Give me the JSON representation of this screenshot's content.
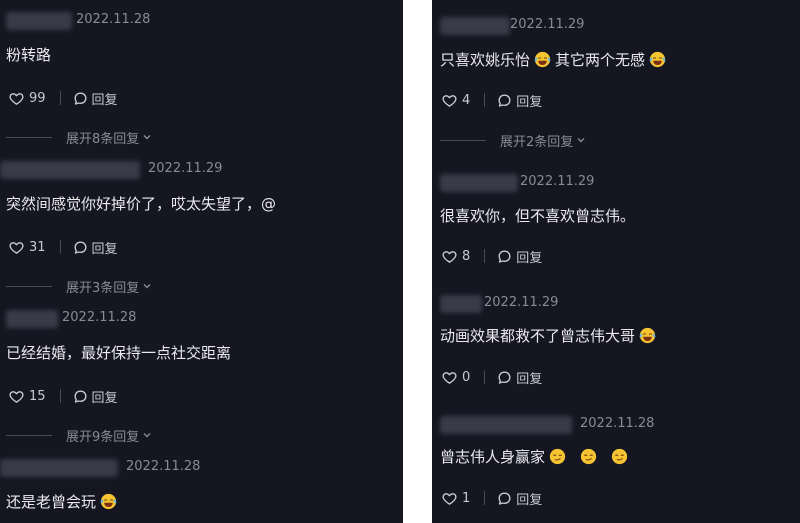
{
  "left_comments": [
    {
      "date": "2022.11.28",
      "text": "粉转路",
      "likes": "99",
      "reply_label": "回复",
      "expand_label": "展开8条回复",
      "expand_icon": "chevron-down-icon"
    },
    {
      "date": "2022.11.29",
      "text": "突然间感觉你好掉价了，哎太失望了，@",
      "likes": "31",
      "reply_label": "回复",
      "expand_label": "展开3条回复",
      "expand_icon": "chevron-down-icon"
    },
    {
      "date": "2022.11.28",
      "text": "已经结婚，最好保持一点社交距离",
      "likes": "15",
      "reply_label": "回复",
      "expand_label": "展开9条回复",
      "expand_icon": "chevron-down-icon"
    },
    {
      "date": "2022.11.28",
      "text": "还是老曾会玩",
      "emoji_after": "laughing-crying-emoji"
    }
  ],
  "right_comments": [
    {
      "date": "2022.11.29",
      "text_before": "只喜欢姚乐怡",
      "text_after": "其它两个无感",
      "emoji_mid": "rolling-laughing-emoji",
      "emoji_end": "tears-of-joy-emoji",
      "likes": "4",
      "reply_label": "回复",
      "expand_label": "展开2条回复",
      "expand_icon": "chevron-down-icon"
    },
    {
      "date": "2022.11.29",
      "text": "很喜欢你，但不喜欢曾志伟。",
      "likes": "8",
      "reply_label": "回复"
    },
    {
      "date": "2022.11.29",
      "text": "动画效果都救不了曾志伟大哥",
      "emoji_end": "tears-of-joy-emoji",
      "likes": "0",
      "reply_label": "回复"
    },
    {
      "date": "2022.11.28",
      "text": "曾志伟人身赢家",
      "emojis": [
        "smirk-emoji",
        "smirk-emoji",
        "smirk-emoji"
      ],
      "likes": "1",
      "reply_label": "回复"
    }
  ],
  "colors": {
    "background": "#161622",
    "text": "#e9e9ee",
    "muted": "#8a8a96",
    "emoji": "#f6c431"
  }
}
